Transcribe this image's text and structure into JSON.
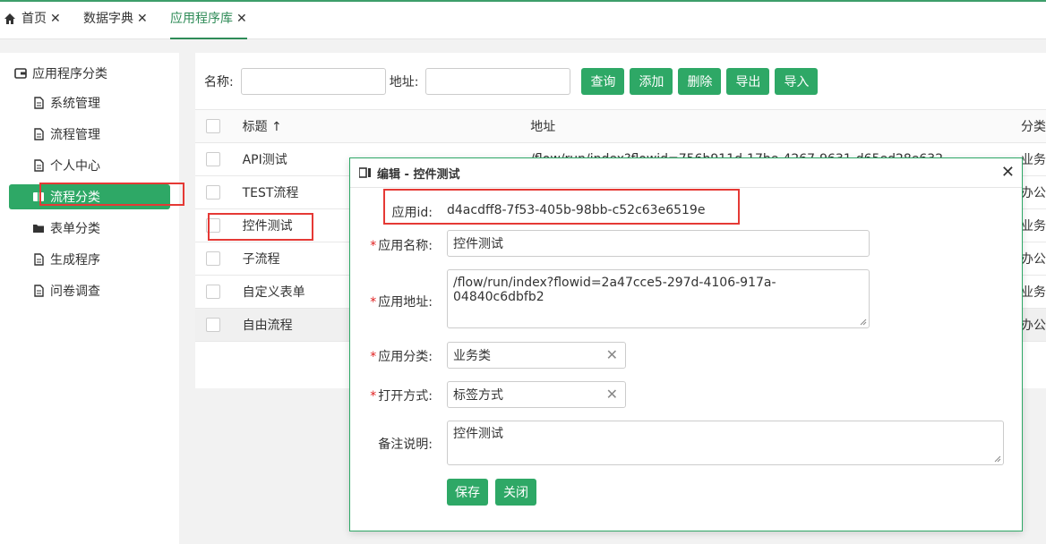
{
  "tabs": [
    {
      "label": "首页",
      "close": "✕",
      "icon": "home-icon"
    },
    {
      "label": "数据字典",
      "close": "✕"
    },
    {
      "label": "应用程序库",
      "close": "✕"
    }
  ],
  "tree": {
    "root_label": "应用程序分类",
    "items": [
      {
        "label": "系统管理",
        "icon": "document-icon"
      },
      {
        "label": "流程管理",
        "icon": "document-icon"
      },
      {
        "label": "个人中心",
        "icon": "document-icon"
      },
      {
        "label": "流程分类",
        "icon": "folder-icon"
      },
      {
        "label": "表单分类",
        "icon": "folder-icon"
      },
      {
        "label": "生成程序",
        "icon": "document-icon"
      },
      {
        "label": "问卷调查",
        "icon": "document-icon"
      }
    ]
  },
  "search": {
    "name_label": "名称:",
    "address_label": "地址:",
    "buttons": [
      "查询",
      "添加",
      "删除",
      "导出",
      "导入"
    ]
  },
  "grid": {
    "headers": [
      "标题",
      "地址",
      "分类"
    ],
    "sort_indicator": "↑",
    "rows": [
      {
        "title": "API测试",
        "address": "/flow/run/index?flowid=756b911d-17be-4267-9631-d65ed28e632",
        "category": "业务类"
      },
      {
        "title": "TEST流程",
        "address": "",
        "category": "办公类"
      },
      {
        "title": "控件测试",
        "address": "",
        "category": "业务类"
      },
      {
        "title": "子流程",
        "address": "",
        "category": "办公类"
      },
      {
        "title": "自定义表单",
        "address": "",
        "category": "业务类"
      },
      {
        "title": "自由流程",
        "address": "",
        "category": "办公类"
      }
    ]
  },
  "modal": {
    "title": "编辑 - 控件测试",
    "close": "✕",
    "app_id_label": "应用id:",
    "app_id_value": "d4acdff8-7f53-405b-98bb-c52c63e6519e",
    "required_mark": "*",
    "name_label": "应用名称:",
    "name_value": "控件测试",
    "address_label": "应用地址:",
    "address_value": "/flow/run/index?flowid=2a47cce5-297d-4106-917a-04840c6dbfb2",
    "category_label": "应用分类:",
    "category_value": "业务类",
    "open_mode_label": "打开方式:",
    "open_mode_value": "标签方式",
    "clear": "✕",
    "notes_label": "备注说明:",
    "notes_value": "控件测试",
    "save_label": "保存",
    "close_label": "关闭"
  },
  "colors": {
    "accent": "#2ea866",
    "highlight": "#e53935"
  }
}
